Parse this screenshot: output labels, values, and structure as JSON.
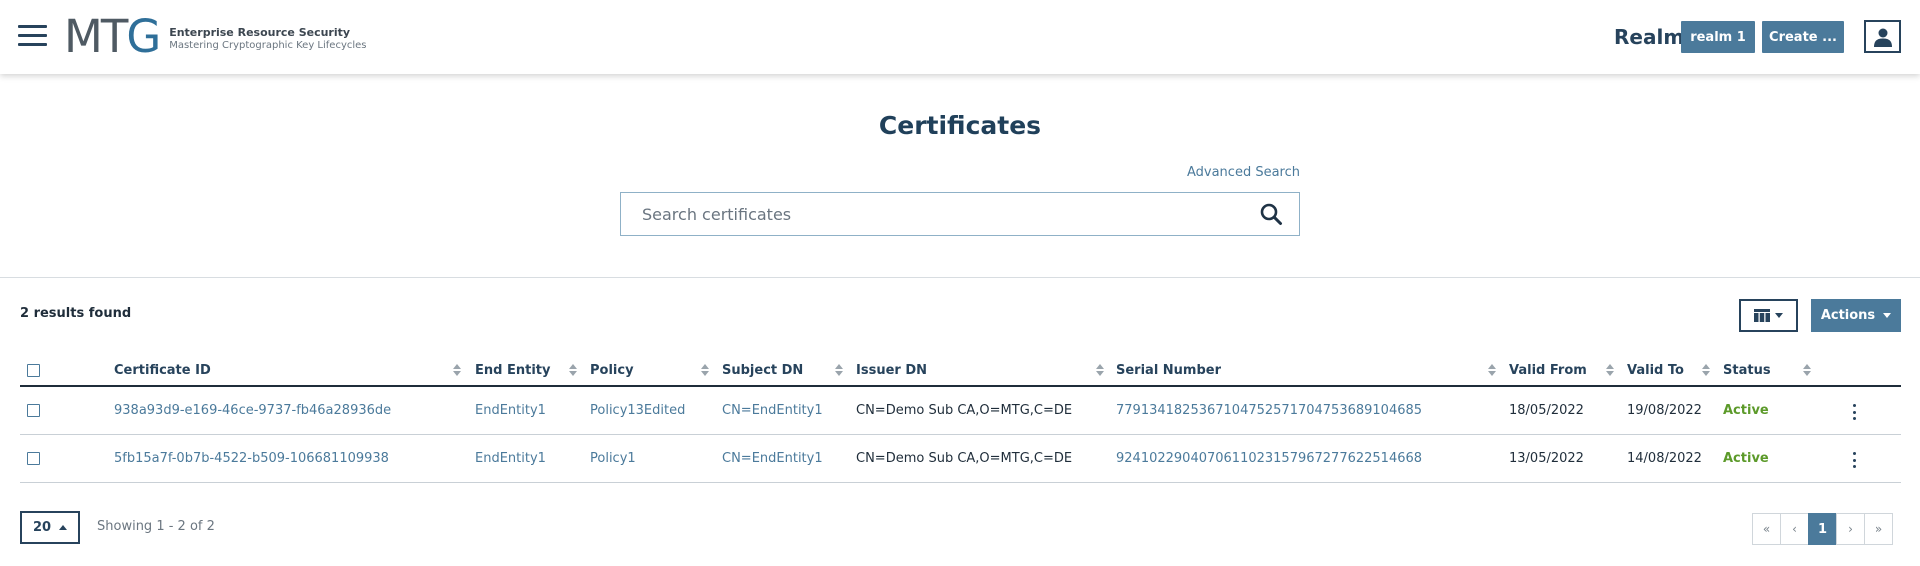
{
  "header": {
    "logo_mark_main": "MT",
    "logo_mark_accent": "G",
    "logo_title": "Enterprise Resource Security",
    "logo_subtitle": "Mastering Cryptographic Key Lifecycles",
    "realm_label": "Realm:",
    "realm_button": "realm 1",
    "create_button": "Create ...",
    "icons": [
      "hamburger-menu-icon",
      "user-icon"
    ]
  },
  "main": {
    "title": "Certificates",
    "advanced_search": "Advanced Search",
    "search": {
      "placeholder": "Search certificates",
      "value": "",
      "icon": "search-icon"
    }
  },
  "toolbar": {
    "results_text": "2 results found",
    "columns_icon": "table-columns-icon",
    "actions_label": "Actions"
  },
  "table": {
    "columns": [
      "Certificate ID",
      "End Entity",
      "Policy",
      "Subject DN",
      "Issuer DN",
      "Serial Number",
      "Valid From",
      "Valid To",
      "Status"
    ],
    "rows": [
      {
        "certificate_id": "938a93d9-e169-46ce-9737-fb46a28936de",
        "end_entity": "EndEntity1",
        "policy": "Policy13Edited",
        "subject_dn": "CN=EndEntity1",
        "issuer_dn": "CN=Demo Sub CA,O=MTG,C=DE",
        "serial_number": "779134182536710475257170475368910468​5",
        "valid_from": "18/05/2022",
        "valid_to": "19/08/2022",
        "status": "Active"
      },
      {
        "certificate_id": "5fb15a7f-0b7b-4522-b509-106681109938",
        "end_entity": "EndEntity1",
        "policy": "Policy1",
        "subject_dn": "CN=EndEntity1",
        "issuer_dn": "CN=Demo Sub CA,O=MTG,C=DE",
        "serial_number": "92410229040706110231579672776225146​68",
        "valid_from": "13/05/2022",
        "valid_to": "14/08/2022",
        "status": "Active"
      }
    ]
  },
  "footer": {
    "page_size": "20",
    "showing": "Showing 1 - 2 of 2",
    "pager": {
      "first": "«",
      "prev": "‹",
      "current": "1",
      "next": "›",
      "last": "»"
    }
  },
  "colors": {
    "primary": "#4b7a9b",
    "dark": "#27435c",
    "active_status": "#5c9a2a"
  }
}
